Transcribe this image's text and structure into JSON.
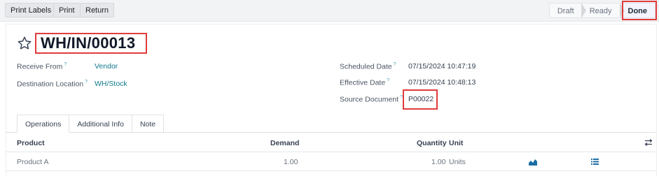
{
  "toolbar": {
    "print_labels": "Print Labels",
    "print": "Print",
    "return": "Return"
  },
  "statusbar": {
    "draft": "Draft",
    "ready": "Ready",
    "done": "Done",
    "active": "Done"
  },
  "record": {
    "title": "WH/IN/00013",
    "receive_from_label": "Receive From",
    "receive_from_value": "Vendor",
    "destination_label": "Destination Location",
    "destination_value": "WH/Stock",
    "scheduled_label": "Scheduled Date",
    "scheduled_value": "07/15/2024 10:47:19",
    "effective_label": "Effective Date",
    "effective_value": "07/15/2024 10:48:13",
    "source_label": "Source Document",
    "source_value": "P00022",
    "help_mark": "?"
  },
  "tabs": [
    "Operations",
    "Additional Info",
    "Note"
  ],
  "table": {
    "headers": {
      "product": "Product",
      "demand": "Demand",
      "quantity": "Quantity",
      "unit": "Unit"
    },
    "rows": [
      {
        "product": "Product A",
        "demand": "1.00",
        "quantity": "1.00",
        "unit": "Units"
      }
    ]
  },
  "icons": {
    "favorite": "star-icon",
    "forecast": "chart-icon",
    "details": "list-icon",
    "optional_columns": "settings-sliders-icon"
  },
  "colors": {
    "link": "#117a8b",
    "highlight": "#e03c3c",
    "icon_accent": "#1d6fa5"
  }
}
